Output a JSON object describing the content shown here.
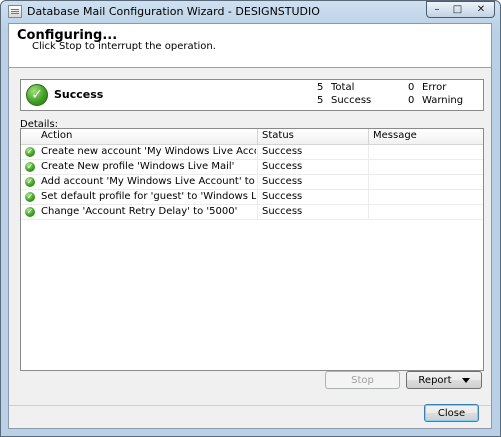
{
  "window": {
    "title": "Database Mail Configuration Wizard - DESIGNSTUDIO"
  },
  "header": {
    "title": "Configuring...",
    "subtitle": "Click Stop to interrupt the operation."
  },
  "status": {
    "label": "Success",
    "total_count": "5",
    "total_label": "Total",
    "success_count": "5",
    "success_label": "Success",
    "error_count": "0",
    "error_label": "Error",
    "warning_count": "0",
    "warning_label": "Warning"
  },
  "details": {
    "label": "Details:",
    "columns": {
      "action": "Action",
      "status": "Status",
      "message": "Message"
    },
    "rows": [
      {
        "action": "Create new account 'My Windows Live Account' for SMT...",
        "status": "Success",
        "message": ""
      },
      {
        "action": "Create New profile 'Windows Live Mail'",
        "status": "Success",
        "message": ""
      },
      {
        "action": "Add account 'My Windows Live Account' to profile 'Windo...",
        "status": "Success",
        "message": ""
      },
      {
        "action": "Set default profile for 'guest' to 'Windows Live Mail'",
        "status": "Success",
        "message": ""
      },
      {
        "action": "Change 'Account Retry Delay' to '5000'",
        "status": "Success",
        "message": ""
      }
    ]
  },
  "buttons": {
    "stop": "Stop",
    "report": "Report",
    "close": "Close"
  },
  "icons": {
    "status": "success-check-icon",
    "row": "success-check-icon"
  },
  "colors": {
    "success_green": "#3c9b22",
    "title_bar": "#b9d0e6"
  }
}
